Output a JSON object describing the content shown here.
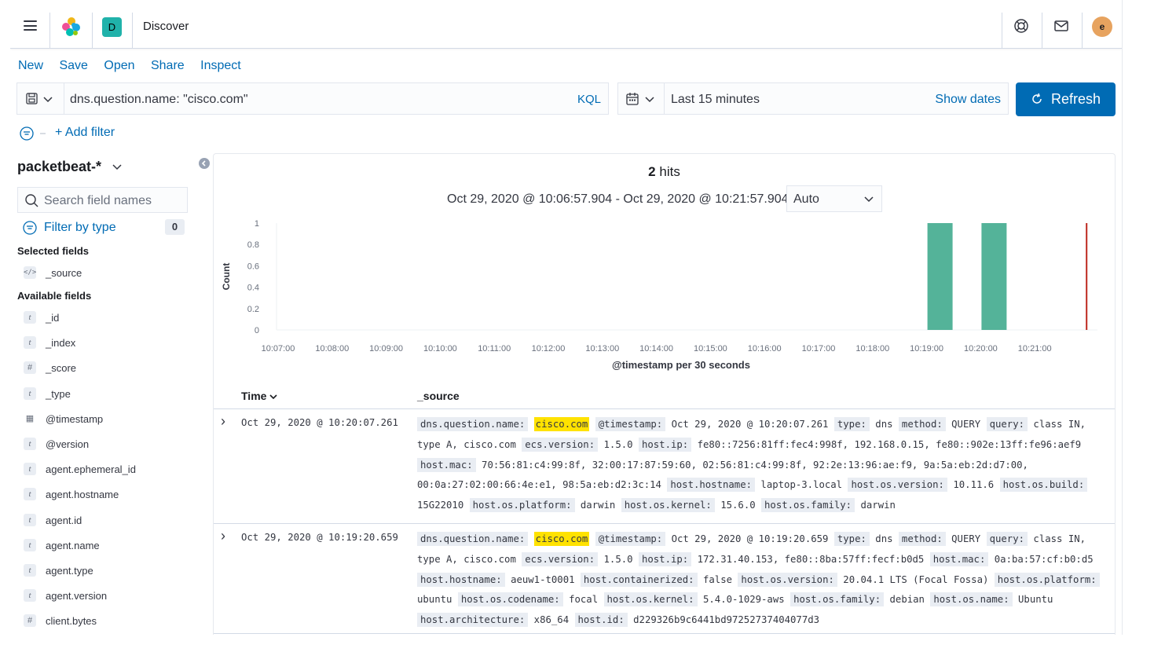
{
  "header": {
    "space_initial": "D",
    "title": "Discover",
    "avatar_initial": "e"
  },
  "topnav": {
    "items": [
      "New",
      "Save",
      "Open",
      "Share",
      "Inspect"
    ]
  },
  "query": {
    "text": "dns.question.name: \"cisco.com\"",
    "language": "KQL"
  },
  "time": {
    "range": "Last 15 minutes",
    "show_dates": "Show dates",
    "refresh": "Refresh"
  },
  "filters": {
    "add": "+ Add filter"
  },
  "sidebar": {
    "index_pattern": "packetbeat-*",
    "search_placeholder": "Search field names",
    "filter_by_type": "Filter by type",
    "filter_count": "0",
    "selected_heading": "Selected fields",
    "selected_fields": [
      {
        "name": "_source",
        "type": "source"
      }
    ],
    "available_heading": "Available fields",
    "available_fields": [
      {
        "name": "_id",
        "type": "t"
      },
      {
        "name": "_index",
        "type": "t"
      },
      {
        "name": "_score",
        "type": "#"
      },
      {
        "name": "_type",
        "type": "t"
      },
      {
        "name": "@timestamp",
        "type": "date"
      },
      {
        "name": "@version",
        "type": "t"
      },
      {
        "name": "agent.ephemeral_id",
        "type": "t"
      },
      {
        "name": "agent.hostname",
        "type": "t"
      },
      {
        "name": "agent.id",
        "type": "t"
      },
      {
        "name": "agent.name",
        "type": "t"
      },
      {
        "name": "agent.type",
        "type": "t"
      },
      {
        "name": "agent.version",
        "type": "t"
      },
      {
        "name": "client.bytes",
        "type": "#"
      }
    ]
  },
  "hits": {
    "count": "2",
    "label": "hits"
  },
  "interval": {
    "range_text": "Oct 29, 2020 @ 10:06:57.904 - Oct 29, 2020 @ 10:21:57.904",
    "selected": "Auto"
  },
  "chart_data": {
    "type": "bar",
    "x": [
      "10:19:00",
      "10:20:00"
    ],
    "values": [
      1,
      1
    ],
    "xticks": [
      "10:07:00",
      "10:08:00",
      "10:09:00",
      "10:10:00",
      "10:11:00",
      "10:12:00",
      "10:13:00",
      "10:14:00",
      "10:15:00",
      "10:16:00",
      "10:17:00",
      "10:18:00",
      "10:19:00",
      "10:20:00",
      "10:21:00"
    ],
    "yticks": [
      "1",
      "0.8",
      "0.6",
      "0.4",
      "0.2",
      "0"
    ],
    "ylim": [
      0,
      1
    ],
    "ylabel": "Count",
    "xlabel": "@timestamp per 30 seconds",
    "bar_color": "#54b399",
    "now_marker_color": "#bd271e"
  },
  "table": {
    "columns": [
      "Time",
      "_source"
    ],
    "rows": [
      {
        "time": "Oct 29, 2020 @ 10:20:07.261",
        "fields": [
          [
            "dns.question.name:",
            "cisco.com"
          ],
          [
            "@timestamp:",
            "Oct 29, 2020 @ 10:20:07.261"
          ],
          [
            "type:",
            "dns"
          ],
          [
            "method:",
            "QUERY"
          ],
          [
            "query:",
            "class IN, type A, cisco.com"
          ],
          [
            "ecs.version:",
            "1.5.0"
          ],
          [
            "host.ip:",
            "fe80::7256:81ff:fec4:998f, 192.168.0.15, fe80::902e:13ff:fe96:aef9"
          ],
          [
            "host.mac:",
            "70:56:81:c4:99:8f, 32:00:17:87:59:60, 02:56:81:c4:99:8f, 92:2e:13:96:ae:f9, 9a:5a:eb:2d:d7:00, 00:0a:27:02:00:66:4e:e1, 98:5a:eb:d2:3c:14"
          ],
          [
            "host.hostname:",
            "laptop-3.local"
          ],
          [
            "host.os.version:",
            "10.11.6"
          ],
          [
            "host.os.build:",
            "15G22010"
          ],
          [
            "host.os.platform:",
            "darwin"
          ],
          [
            "host.os.kernel:",
            "15.6.0"
          ],
          [
            "host.os.family:",
            "darwin"
          ]
        ]
      },
      {
        "time": "Oct 29, 2020 @ 10:19:20.659",
        "fields": [
          [
            "dns.question.name:",
            "cisco.com"
          ],
          [
            "@timestamp:",
            "Oct 29, 2020 @ 10:19:20.659"
          ],
          [
            "type:",
            "dns"
          ],
          [
            "method:",
            "QUERY"
          ],
          [
            "query:",
            "class IN, type A, cisco.com"
          ],
          [
            "ecs.version:",
            "1.5.0"
          ],
          [
            "host.ip:",
            "172.31.40.153, fe80::8ba:57ff:fecf:b0d5"
          ],
          [
            "host.mac:",
            "0a:ba:57:cf:b0:d5"
          ],
          [
            "host.hostname:",
            "aeuw1-t0001"
          ],
          [
            "host.containerized:",
            "false"
          ],
          [
            "host.os.version:",
            "20.04.1 LTS (Focal Fossa)"
          ],
          [
            "host.os.platform:",
            "ubuntu"
          ],
          [
            "host.os.codename:",
            "focal"
          ],
          [
            "host.os.kernel:",
            "5.4.0-1029-aws"
          ],
          [
            "host.os.family:",
            "debian"
          ],
          [
            "host.os.name:",
            "Ubuntu"
          ],
          [
            "host.architecture:",
            "x86_64"
          ],
          [
            "host.id:",
            "d229326b9c6441bd97252737404077d3"
          ]
        ]
      }
    ]
  }
}
